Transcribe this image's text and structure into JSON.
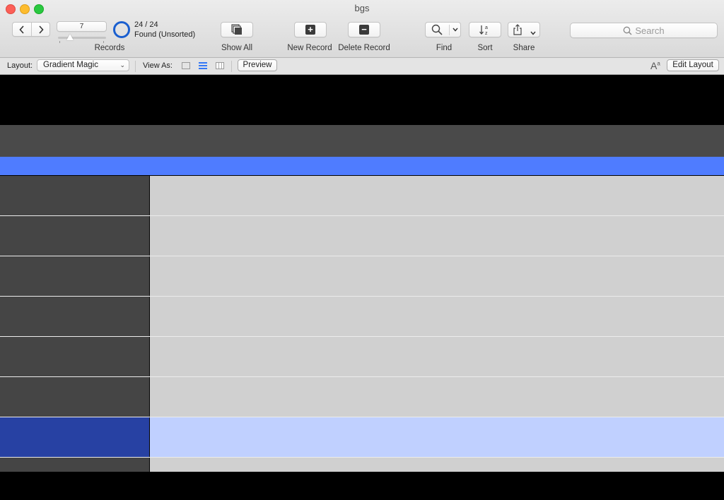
{
  "window": {
    "title": "bgs"
  },
  "toolbar": {
    "record_number": "7",
    "records_label": "Records",
    "found_count": "24 / 24",
    "found_state": "Found (Unsorted)",
    "show_all_label": "Show All",
    "new_record_label": "New Record",
    "delete_record_label": "Delete Record",
    "find_label": "Find",
    "sort_label": "Sort",
    "share_label": "Share",
    "search_placeholder": "Search",
    "record_slider_fraction": 0.25
  },
  "layout_bar": {
    "layout_label": "Layout:",
    "layout_value": "Gradient Magic",
    "view_as_label": "View As:",
    "preview_label": "Preview",
    "edit_layout_label": "Edit Layout",
    "active_view": "list"
  },
  "content": {
    "record_rows": 8,
    "selected_row": 7
  },
  "colors": {
    "header_gray": "#4a4a4a",
    "accent_blue": "#4f7cff",
    "row_left": "#454545",
    "row_right": "#d0d0d0",
    "selected_left": "#2741a3",
    "selected_right": "#c0d0ff"
  },
  "icons": {
    "nav_back": "chevron-left-icon",
    "nav_forward": "chevron-right-icon",
    "show_all": "stack-icon",
    "new_record": "plus-square-icon",
    "delete_record": "minus-square-icon",
    "find": "magnifier-icon",
    "sort": "sort-az-icon",
    "share": "share-icon",
    "search": "search-icon",
    "font": "font-size-icon"
  }
}
